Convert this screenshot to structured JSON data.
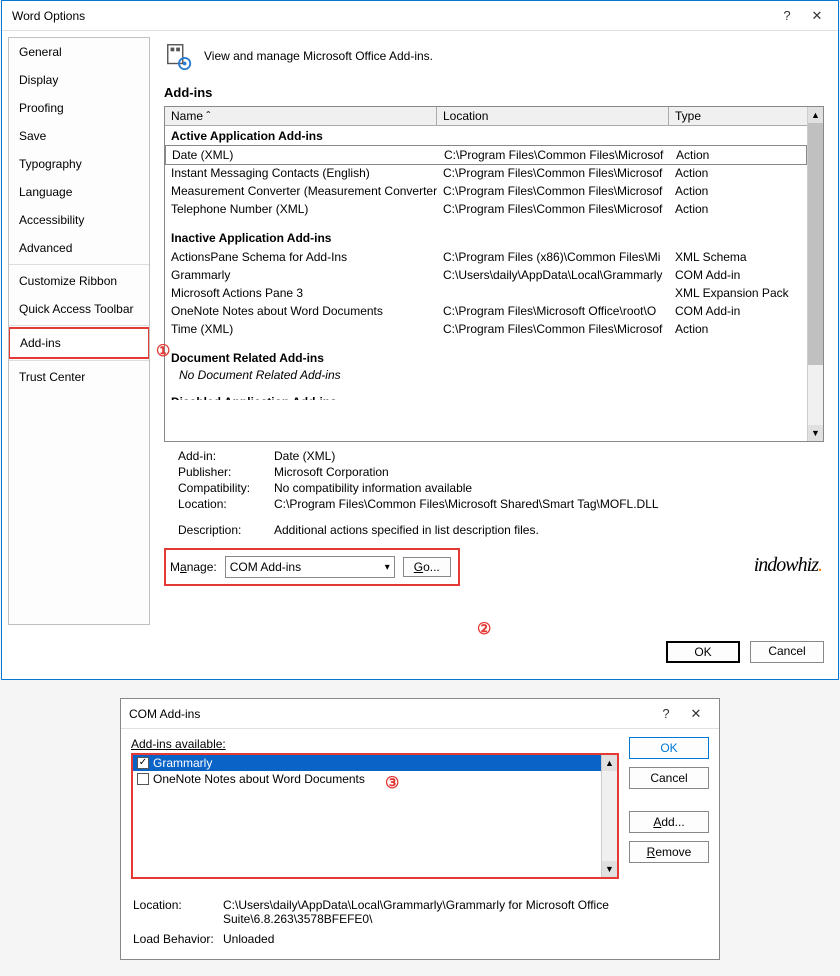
{
  "dialog1": {
    "title": "Word Options",
    "sidebar": [
      "General",
      "Display",
      "Proofing",
      "Save",
      "Typography",
      "Language",
      "Accessibility",
      "Advanced"
    ],
    "sidebar2": [
      "Customize Ribbon",
      "Quick Access Toolbar"
    ],
    "sidebar3": [
      "Add-ins"
    ],
    "sidebar4": [
      "Trust Center"
    ],
    "header": "View and manage Microsoft Office Add-ins.",
    "section": "Add-ins",
    "cols": {
      "name": "Name ˆ",
      "loc": "Location",
      "type": "Type"
    },
    "g1": "Active Application Add-ins",
    "active": [
      {
        "n": "Date (XML)",
        "l": "C:\\Program Files\\Common Files\\Microsof",
        "t": "Action",
        "sel": true
      },
      {
        "n": "Instant Messaging Contacts (English)",
        "l": "C:\\Program Files\\Common Files\\Microsof",
        "t": "Action"
      },
      {
        "n": "Measurement Converter (Measurement Converter)",
        "l": "C:\\Program Files\\Common Files\\Microsof",
        "t": "Action"
      },
      {
        "n": "Telephone Number (XML)",
        "l": "C:\\Program Files\\Common Files\\Microsof",
        "t": "Action"
      }
    ],
    "g2": "Inactive Application Add-ins",
    "inactive": [
      {
        "n": "ActionsPane Schema for Add-Ins",
        "l": "C:\\Program Files (x86)\\Common Files\\Mi",
        "t": "XML Schema"
      },
      {
        "n": "Grammarly",
        "l": "C:\\Users\\daily\\AppData\\Local\\Grammarly",
        "t": "COM Add-in"
      },
      {
        "n": "Microsoft Actions Pane 3",
        "l": "",
        "t": "XML Expansion Pack"
      },
      {
        "n": "OneNote Notes about Word Documents",
        "l": "C:\\Program Files\\Microsoft Office\\root\\O",
        "t": "COM Add-in"
      },
      {
        "n": "Time (XML)",
        "l": "C:\\Program Files\\Common Files\\Microsof",
        "t": "Action"
      }
    ],
    "g3": "Document Related Add-ins",
    "g3empty": "No Document Related Add-ins",
    "g4": "Disabled Application Add-ins",
    "details": {
      "addin_l": "Add-in:",
      "addin_v": "Date (XML)",
      "pub_l": "Publisher:",
      "pub_v": "Microsoft Corporation",
      "comp_l": "Compatibility:",
      "comp_v": "No compatibility information available",
      "loc_l": "Location:",
      "loc_v": "C:\\Program Files\\Common Files\\Microsoft Shared\\Smart Tag\\MOFL.DLL",
      "desc_l": "Description:",
      "desc_v": "Additional actions specified in list description files."
    },
    "manage_l": "Manage:",
    "manage_sel": "COM Add-ins",
    "go": "Go...",
    "ok": "OK",
    "cancel": "Cancel",
    "watermark": "indowhiz"
  },
  "dialog2": {
    "title": "COM Add-ins",
    "avail_l": "Add-ins available:",
    "items": [
      {
        "n": "Grammarly",
        "checked": true,
        "sel": true
      },
      {
        "n": "OneNote Notes about Word Documents",
        "checked": false
      }
    ],
    "ok": "OK",
    "cancel": "Cancel",
    "add": "Add...",
    "remove": "Remove",
    "loc_l": "Location:",
    "loc_v": "C:\\Users\\daily\\AppData\\Local\\Grammarly\\Grammarly for Microsoft Office Suite\\6.8.263\\3578BFEFE0\\",
    "lb_l": "Load Behavior:",
    "lb_v": "Unloaded"
  },
  "callouts": {
    "c1": "①",
    "c2": "②",
    "c3": "③"
  }
}
